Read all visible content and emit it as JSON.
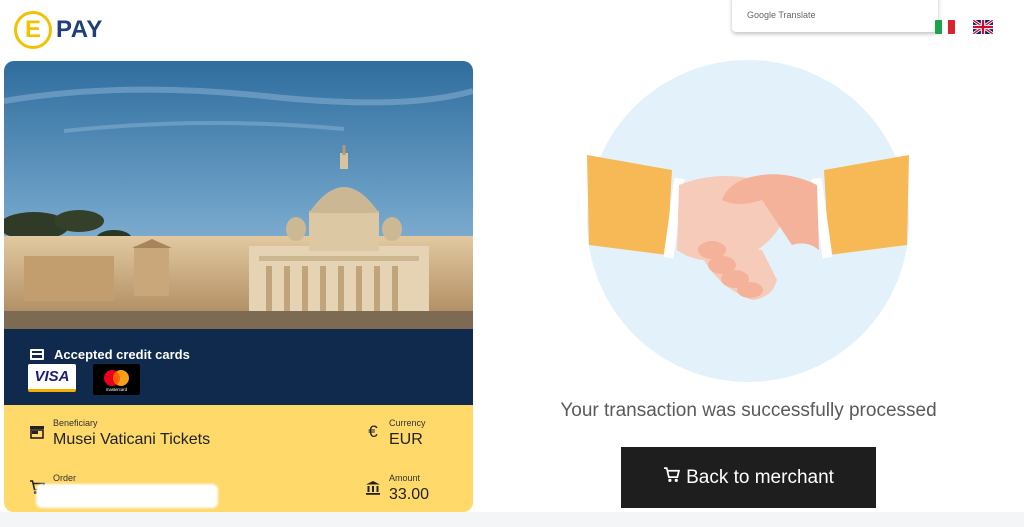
{
  "header": {
    "logo_letter": "E",
    "logo_text": "PAY"
  },
  "translate": {
    "brand": "Google Translate"
  },
  "languages": [
    {
      "code": "it",
      "icon": "italy-flag-icon"
    },
    {
      "code": "en",
      "icon": "uk-flag-icon"
    }
  ],
  "card": {
    "accepted_title": "Accepted credit cards",
    "cards": [
      "VISA",
      "mastercard"
    ],
    "beneficiary_label": "Beneficiary",
    "beneficiary_value": "Musei Vaticani Tickets",
    "currency_label": "Currency",
    "currency_value": "EUR",
    "order_label": "Order",
    "amount_label": "Amount",
    "amount_value": "33.00"
  },
  "result": {
    "message": "Your transaction was successfully processed",
    "back_button": "Back to merchant"
  },
  "colors": {
    "brand_yellow": "#f2c200",
    "brand_blue": "#1f3f7a",
    "card_navy": "#0f2a4d",
    "info_yellow": "#ffd96a",
    "button_dark": "#1e1e1e"
  }
}
